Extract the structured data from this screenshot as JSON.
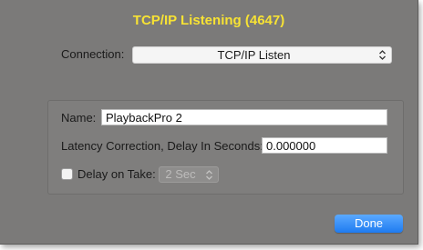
{
  "window": {
    "title": "TCP/IP Listening (4647)"
  },
  "connection": {
    "label": "Connection:",
    "selected": "TCP/IP Listen"
  },
  "settings": {
    "name_label": "Name:",
    "name_value": "PlaybackPro 2",
    "latency_label": "Latency Correction, Delay In Seconds:",
    "latency_value": "0.000000",
    "delay_on_take_label": "Delay on Take:",
    "delay_on_take_checked": false,
    "delay_select_value": "2 Sec"
  },
  "footer": {
    "done_label": "Done"
  },
  "colors": {
    "title": "#f7e234",
    "dialog_bg": "#7b7a79",
    "accent_button": "#1e7bf0"
  },
  "icons": {
    "select_arrows": "chevron-updown-icon"
  }
}
